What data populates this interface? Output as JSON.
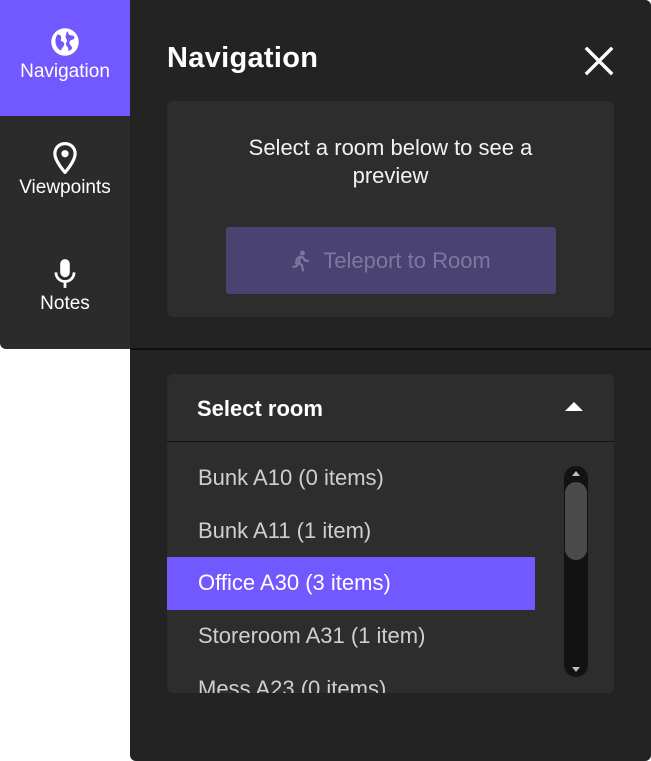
{
  "tabs": [
    {
      "label": "Navigation",
      "icon": "globe-icon",
      "active": true
    },
    {
      "label": "Viewpoints",
      "icon": "location-pin-icon",
      "active": false
    },
    {
      "label": "Notes",
      "icon": "microphone-icon",
      "active": false
    }
  ],
  "panel": {
    "title": "Navigation",
    "close_icon": "close-icon",
    "preview_text": "Select a room below to see a preview",
    "teleport_label": "Teleport to Room",
    "teleport_icon": "walking-person-icon"
  },
  "select": {
    "label": "Select room",
    "items": [
      "Bunk A10 (0 items)",
      "Bunk A11 (1 item)",
      "Office A30 (3 items)",
      "Storeroom A31 (1 item)",
      "Mess A23 (0 items)"
    ],
    "selected": "Office A30 (3 items)"
  },
  "colors": {
    "accent": "#7159ff",
    "panel": "#232323",
    "card": "#2d2d2d",
    "rail": "#2b2b2b"
  }
}
